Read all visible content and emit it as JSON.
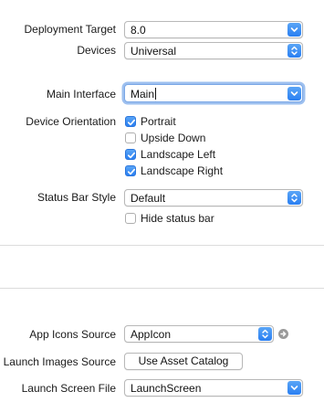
{
  "deployment": {
    "target_label": "Deployment Target",
    "target_value": "8.0",
    "devices_label": "Devices",
    "devices_value": "Universal"
  },
  "interface": {
    "main_label": "Main Interface",
    "main_value": "Main"
  },
  "orientation": {
    "label": "Device Orientation",
    "options": [
      {
        "label": "Portrait",
        "checked": true
      },
      {
        "label": "Upside Down",
        "checked": false
      },
      {
        "label": "Landscape Left",
        "checked": true
      },
      {
        "label": "Landscape Right",
        "checked": true
      }
    ]
  },
  "status_bar": {
    "label": "Status Bar Style",
    "value": "Default",
    "hide_label": "Hide status bar",
    "hide_checked": false
  },
  "icons": {
    "app_icons_label": "App Icons Source",
    "app_icons_value": "AppIcon",
    "launch_images_label": "Launch Images Source",
    "launch_images_button": "Use Asset Catalog",
    "launch_screen_label": "Launch Screen File",
    "launch_screen_value": "LaunchScreen"
  },
  "icon_names": {
    "dropdown": "chevron-down-icon",
    "stepper": "up-down-chevrons-icon",
    "checkmark": "checkmark-icon",
    "goto": "arrow-right-circle-icon"
  },
  "colors": {
    "accent": "#2a7ff2",
    "focus_ring": "#9ec0ef",
    "separator": "#dcdcdc"
  }
}
